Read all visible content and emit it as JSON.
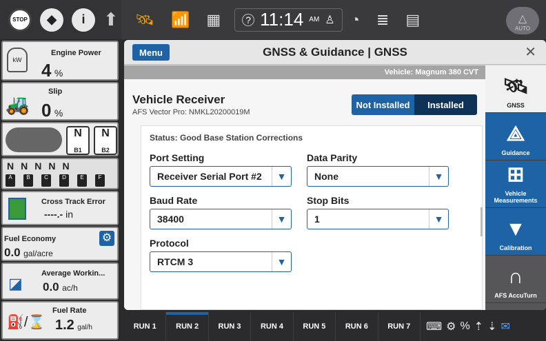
{
  "topbar": {
    "time": "11:14",
    "ampm": "AM",
    "auto_label": "AUTO",
    "stop_label": "STOP"
  },
  "sidebar": {
    "engine_power": {
      "label": "Engine Power",
      "value": "4",
      "unit": "%",
      "icon_text": "kW"
    },
    "slip": {
      "label": "Slip",
      "value": "0",
      "unit": "%"
    },
    "hitch": {
      "b1": "B1",
      "b2": "B2",
      "n": "N"
    },
    "remotes": {
      "letters": [
        "N",
        "N",
        "N",
        "N",
        "N"
      ],
      "tags": [
        "A",
        "B",
        "C",
        "D",
        "E",
        "F"
      ]
    },
    "cross_track": {
      "label": "Cross Track Error",
      "value": "----.-",
      "unit": "in"
    },
    "fuel_economy": {
      "label": "Fuel Economy",
      "value": "0.0",
      "unit": "gal/acre"
    },
    "avg_work": {
      "label": "Average Workin...",
      "value": "0.0",
      "unit": "ac/h"
    },
    "fuel_rate": {
      "label": "Fuel Rate",
      "value": "1.2",
      "unit": "gal/h"
    }
  },
  "main": {
    "menu_label": "Menu",
    "title": "GNSS & Guidance | GNSS",
    "close": "✕",
    "vehicle": "Vehicle: Magnum 380 CVT",
    "receiver_title": "Vehicle Receiver",
    "receiver_sub": "AFS Vector Pro: NMKL20200019M",
    "not_installed": "Not Installed",
    "installed": "Installed",
    "status": "Status: Good Base Station Corrections",
    "port_label": "Port Setting",
    "port_value": "Receiver Serial Port #2",
    "parity_label": "Data Parity",
    "parity_value": "None",
    "baud_label": "Baud Rate",
    "baud_value": "38400",
    "stop_label": "Stop Bits",
    "stop_value": "1",
    "protocol_label": "Protocol",
    "protocol_value": "RTCM 3"
  },
  "rnav": [
    {
      "label": "GNSS",
      "icon": "satellite-icon"
    },
    {
      "label": "Guidance",
      "icon": "guidance-icon"
    },
    {
      "label": "Vehicle Measurements",
      "icon": "tractor-measure-icon"
    },
    {
      "label": "Calibration",
      "icon": "calibration-icon"
    },
    {
      "label": "AFS AccuTurn",
      "icon": "accuturn-icon"
    }
  ],
  "runs": [
    "RUN 1",
    "RUN 2",
    "RUN 3",
    "RUN 4",
    "RUN 5",
    "RUN 6",
    "RUN 7"
  ]
}
